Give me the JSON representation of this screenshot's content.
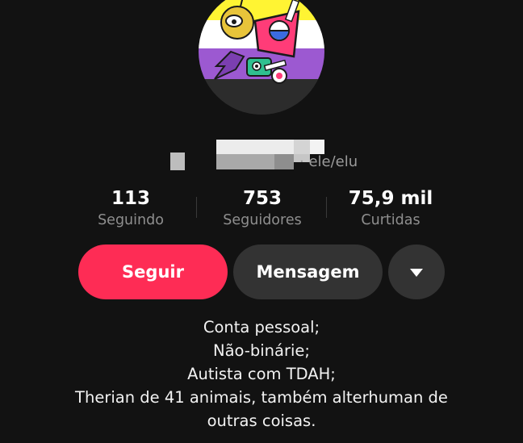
{
  "profile": {
    "pronouns": "· ele/elu",
    "avatar_icon": "nonbinary-flag-character-avatar"
  },
  "stats": [
    {
      "value": "113",
      "label": "Seguindo"
    },
    {
      "value": "753",
      "label": "Seguidores"
    },
    {
      "value": "75,9 mil",
      "label": "Curtidas"
    }
  ],
  "actions": {
    "follow_label": "Seguir",
    "message_label": "Mensagem",
    "more_icon": "caret-down-icon"
  },
  "bio": [
    "Conta pessoal;",
    "Não-binárie;",
    "Autista com TDAH;",
    "Therian de 41 animais, também alterhuman de",
    "outras coisas."
  ],
  "colors": {
    "background": "#121212",
    "follow": "#fe2c55",
    "secondary_button": "#333333",
    "muted_text": "#8f8f8f",
    "flag_yellow": "#fff433",
    "flag_white": "#ffffff",
    "flag_purple": "#9c59d1",
    "flag_black": "#2c2c2c"
  }
}
